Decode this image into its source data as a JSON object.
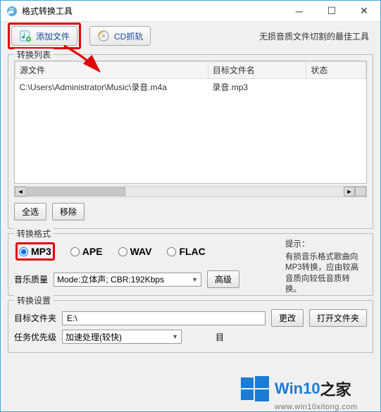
{
  "window": {
    "title": "格式转换工具"
  },
  "toolbar": {
    "add_file": "添加文件",
    "cd_rip": "CD抓轨",
    "tip": "无损音质文件切割的最佳工具"
  },
  "list": {
    "group_title": "转换列表",
    "cols": [
      "源文件",
      "目标文件名",
      "状态"
    ],
    "rows": [
      {
        "source": "C:\\Users\\Administrator\\Music\\录音.m4a",
        "target": "录音.mp3",
        "status": ""
      }
    ],
    "select_all": "全选",
    "remove": "移除"
  },
  "format": {
    "group_title": "转换格式",
    "options": [
      "MP3",
      "APE",
      "WAV",
      "FLAC"
    ],
    "selected": "MP3",
    "quality_label": "音乐质量",
    "quality_value": "Mode:立体声; CBR:192Kbps",
    "advanced": "高级",
    "hint_title": "提示：",
    "hint_body": "有损音乐格式歌曲向MP3转换，应由较高音质向较低音质转换。"
  },
  "settings": {
    "group_title": "转换设置",
    "dest_label": "目标文件夹",
    "dest_value": "E:\\",
    "change": "更改",
    "open_folder": "打开文件夹",
    "priority_label": "任务优先级",
    "priority_value": "加速处理(较快)",
    "partial_label": "目"
  },
  "watermark": {
    "brand1": "Win10",
    "brand2": "之家",
    "url": "www.win10xitong.com"
  },
  "colors": {
    "highlight": "#e10000",
    "accent": "#1a7cd4"
  }
}
